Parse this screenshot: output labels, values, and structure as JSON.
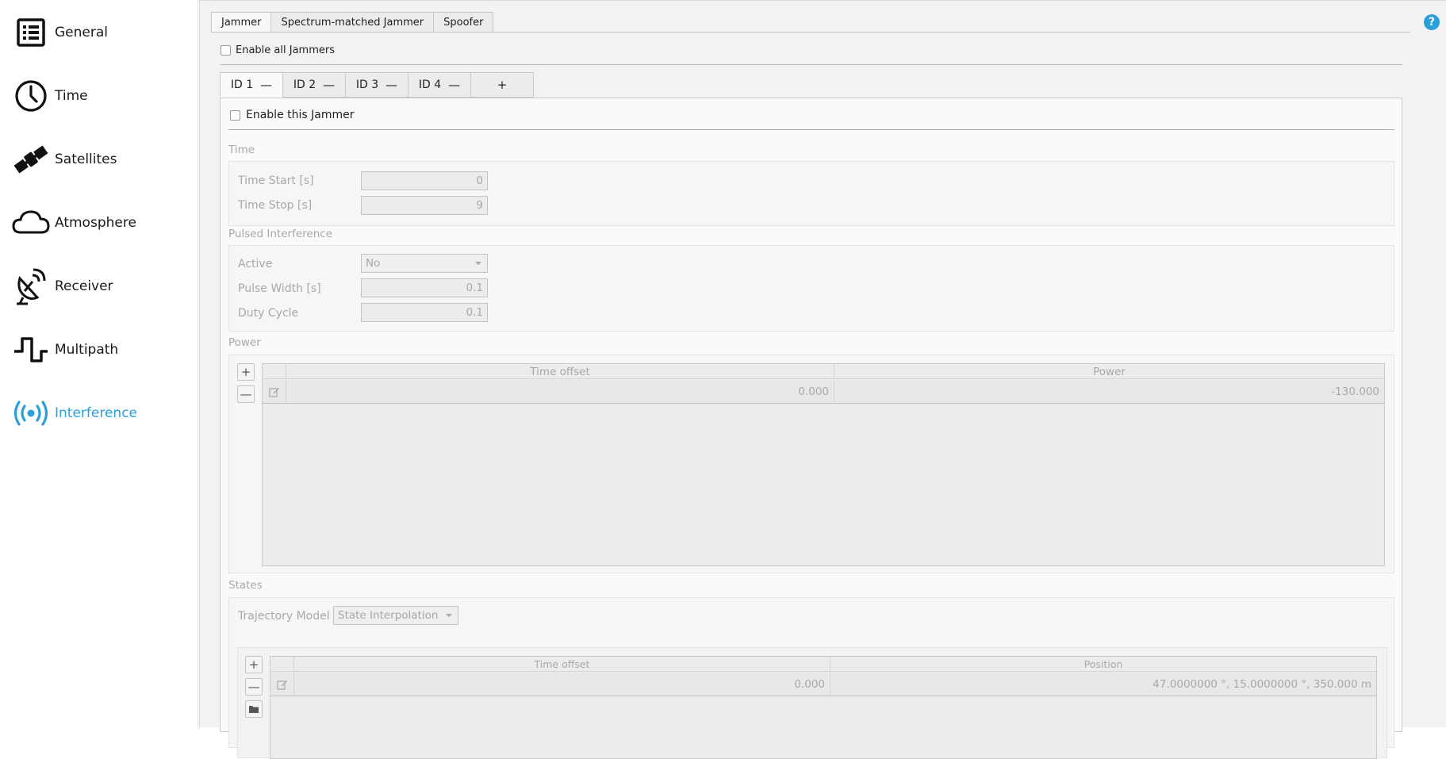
{
  "sidebar": {
    "items": [
      {
        "label": "General",
        "icon": "list-icon"
      },
      {
        "label": "Time",
        "icon": "clock-icon"
      },
      {
        "label": "Satellites",
        "icon": "satellite-icon"
      },
      {
        "label": "Atmosphere",
        "icon": "cloud-icon"
      },
      {
        "label": "Receiver",
        "icon": "dish-icon"
      },
      {
        "label": "Multipath",
        "icon": "multipath-icon"
      },
      {
        "label": "Interference",
        "icon": "broadcast-icon"
      }
    ],
    "active_index": 6,
    "active_color": "#2a9fd8"
  },
  "top_tabs": [
    "Jammer",
    "Spectrum-matched Jammer",
    "Spoofer"
  ],
  "help_label": "?",
  "enable_all_label": "Enable all Jammers",
  "id_tabs": [
    {
      "label": "ID 1",
      "minus": "—"
    },
    {
      "label": "ID 2",
      "minus": "—"
    },
    {
      "label": "ID 3",
      "minus": "—"
    },
    {
      "label": "ID 4",
      "minus": "—"
    }
  ],
  "add_tab_label": "+",
  "enable_this_label": "Enable this Jammer",
  "time_section": {
    "title": "Time",
    "start_label": "Time Start [s]",
    "start_value": "0",
    "stop_label": "Time Stop [s]",
    "stop_value": "9"
  },
  "pulsed_section": {
    "title": "Pulsed Interference",
    "active_label": "Active",
    "active_value": "No",
    "pulse_width_label": "Pulse Width [s]",
    "pulse_width_value": "0.1",
    "duty_cycle_label": "Duty Cycle",
    "duty_cycle_value": "0.1"
  },
  "power_section": {
    "title": "Power",
    "add_label": "+",
    "remove_label": "—",
    "columns": [
      "Time offset",
      "Power"
    ],
    "rows": [
      [
        "0.000",
        "-130.000"
      ]
    ]
  },
  "states_section": {
    "title": "States",
    "trajectory_label": "Trajectory Model",
    "trajectory_value": "State Interpolation",
    "add_label": "+",
    "remove_label": "—",
    "columns": [
      "Time offset",
      "Position"
    ],
    "rows": [
      [
        "0.000",
        "47.0000000 °, 15.0000000 °, 350.000 m"
      ]
    ]
  }
}
